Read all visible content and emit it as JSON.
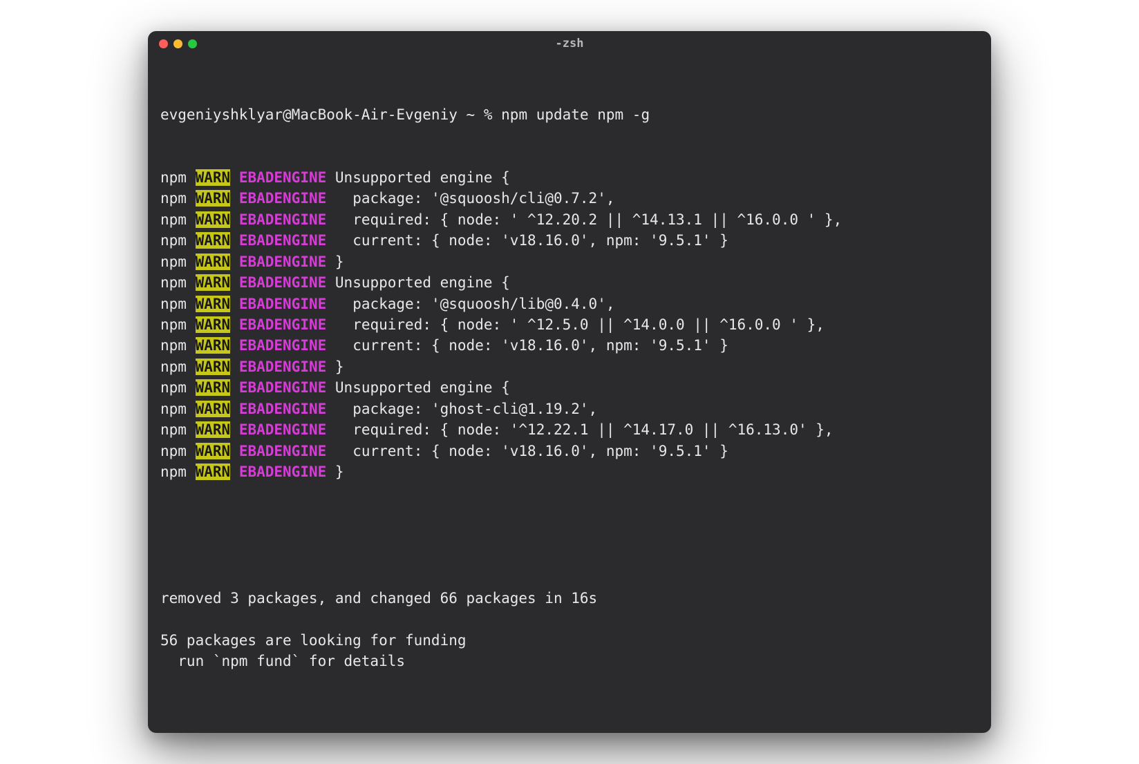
{
  "window": {
    "title": "-zsh"
  },
  "prompt": {
    "user_host": "evgeniyshklyar@MacBook-Air-Evgeniy",
    "path": "~",
    "symbol": "%",
    "command": "npm update npm -g"
  },
  "warn_prefix": {
    "npm": "npm",
    "warn": "WARN",
    "code": "EBADENGINE"
  },
  "warn_lines": [
    " Unsupported engine {",
    "   package: '@squoosh/cli@0.7.2',",
    "   required: { node: ' ^12.20.2 || ^14.13.1 || ^16.0.0 ' },",
    "   current: { node: 'v18.16.0', npm: '9.5.1' }",
    " }",
    " Unsupported engine {",
    "   package: '@squoosh/lib@0.4.0',",
    "   required: { node: ' ^12.5.0 || ^14.0.0 || ^16.0.0 ' },",
    "   current: { node: 'v18.16.0', npm: '9.5.1' }",
    " }",
    " Unsupported engine {",
    "   package: 'ghost-cli@1.19.2',",
    "   required: { node: '^12.22.1 || ^14.17.0 || ^16.13.0' },",
    "   current: { node: 'v18.16.0', npm: '9.5.1' }",
    " }"
  ],
  "footer_lines": [
    "removed 3 packages, and changed 66 packages in 16s",
    "",
    "56 packages are looking for funding",
    "  run `npm fund` for details"
  ]
}
